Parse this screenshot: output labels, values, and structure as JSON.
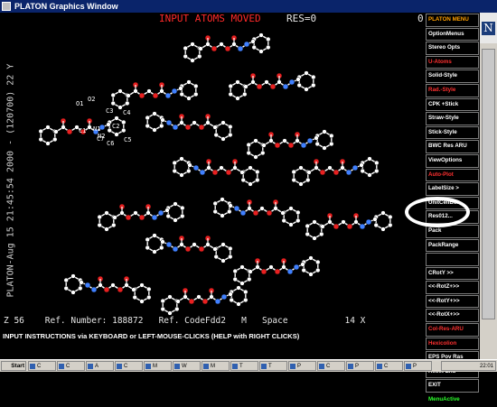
{
  "window": {
    "title": "PLATON Graphics Window"
  },
  "canvas": {
    "status_message": "INPUT ATOMS MOVED",
    "res_label": "RES=0",
    "corner_digit": "0",
    "vertical_label": "PLATON-Aug 15 21:45:54 2000 - (120700) 22 Y",
    "bottom_info": "Z 56    Ref. Number: 188872   Ref. CodeFdd2   M   Space           14 X",
    "atom_labels": [
      "O1",
      "O2",
      "C1",
      "N1",
      "N2",
      "C3",
      "C4",
      "C2",
      "C5",
      "C6",
      "C7"
    ]
  },
  "instructions": "INPUT INSTRUCTIONS via KEYBOARD or LEFT-MOUSE-CLICKS (HELP with RIGHT CLICKS)",
  "menu": {
    "items": [
      {
        "label": "PLATON MENU",
        "color": "title"
      },
      {
        "label": "OptionMenus",
        "color": "white"
      },
      {
        "label": "Stereo Opts",
        "color": "white"
      },
      {
        "label": "U-Atoms",
        "color": "red"
      },
      {
        "label": "Solid-Style",
        "color": "white"
      },
      {
        "label": "Rad.-Style",
        "color": "red"
      },
      {
        "label": "CPK +Stick",
        "color": "white"
      },
      {
        "label": "Straw-Style",
        "color": "white"
      },
      {
        "label": "Stick-Style",
        "color": "white"
      },
      {
        "label": "BWC Res ARU",
        "color": "white"
      },
      {
        "label": "ViewOptions",
        "color": "white"
      },
      {
        "label": "Auto-Plot",
        "color": "red"
      },
      {
        "label": "LabelSize >",
        "color": "white"
      },
      {
        "label": "UnitCellBox",
        "color": "white"
      },
      {
        "label": "Res012...",
        "color": "white"
      },
      {
        "label": "Pack",
        "color": "white"
      },
      {
        "label": "PackRange",
        "color": "white"
      },
      {
        "label": "",
        "color": "white"
      },
      {
        "label": "CRotY >>",
        "color": "white"
      },
      {
        "label": "<<-RotZ+>>",
        "color": "white"
      },
      {
        "label": "<<-RotY+>>",
        "color": "white"
      },
      {
        "label": "<<-RotX+>>",
        "color": "white"
      },
      {
        "label": "Col-Res-ARU",
        "color": "red"
      },
      {
        "label": "Hexicolion",
        "color": "red"
      },
      {
        "label": "EPS Pov Ras",
        "color": "white"
      },
      {
        "label": "Reset  End",
        "color": "white"
      },
      {
        "label": "EXIT",
        "color": "white"
      },
      {
        "label": "MenuActive",
        "color": "green"
      }
    ]
  },
  "taskbar": {
    "start_label": "Start",
    "buttons": [
      "C",
      "C",
      "A",
      "C",
      "M",
      "W",
      "M",
      "T",
      "T",
      "P",
      "C",
      "P",
      "C",
      "P"
    ],
    "clock": "22:01"
  },
  "colors": {
    "title_bar": "#0a246a",
    "status_red": "#ff2a2a",
    "menu_orange": "#ffa000",
    "menu_green": "#2cff2c",
    "oxygen": "#e82020",
    "nitrogen": "#4080ff"
  }
}
